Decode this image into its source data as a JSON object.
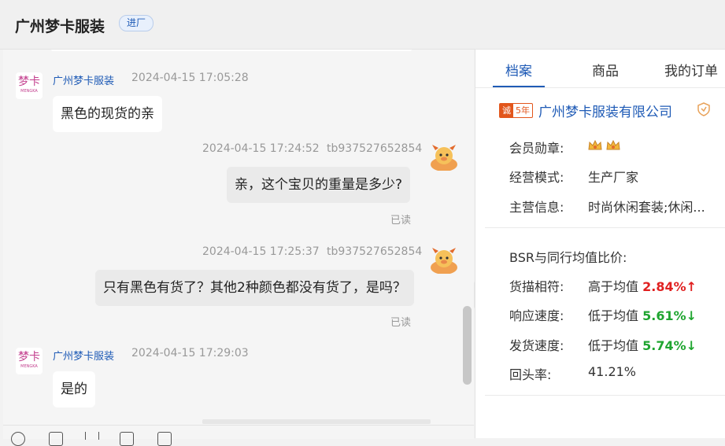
{
  "header": {
    "shop_name": "广州梦卡服装",
    "badge": "进厂"
  },
  "chat": {
    "messages": [
      {
        "sender": "广州梦卡服装",
        "time": "2024-04-15 17:05:28",
        "text": "黑色的现货的亲"
      },
      {
        "sender": "tb937527652854",
        "time": "2024-04-15 17:24:52",
        "text": "亲，这个宝贝的重量是多少?",
        "status": "已读"
      },
      {
        "sender": "tb937527652854",
        "time": "2024-04-15 17:25:37",
        "text": "只有黑色有货了？其他2种颜色都没有货了，是吗？",
        "status": "已读"
      },
      {
        "sender": "广州梦卡服装",
        "time": "2024-04-15 17:29:03",
        "text": "是的"
      }
    ],
    "shop_avatar_text": "梦卡",
    "shop_avatar_sub": "MENGKA"
  },
  "panel": {
    "tabs": [
      "档案",
      "商品",
      "我的订单"
    ],
    "company": {
      "cheng_label": "诚",
      "years": "5年",
      "name": "广州梦卡服装有限公司"
    },
    "info": {
      "member_label": "会员勋章:",
      "mode_label": "经营模式:",
      "mode_value": "生产厂家",
      "main_label": "主营信息:",
      "main_value": "时尚休闲套装;休闲..."
    },
    "bsr": {
      "title": "BSR与同行均值比价:",
      "rows": [
        {
          "label": "货描相符:",
          "prefix": "高于均值",
          "value": "2.84%",
          "arrow": "↑",
          "trend": "up"
        },
        {
          "label": "响应速度:",
          "prefix": "低于均值",
          "value": "5.61%",
          "arrow": "↓",
          "trend": "down"
        },
        {
          "label": "发货速度:",
          "prefix": "低于均值",
          "value": "5.74%",
          "arrow": "↓",
          "trend": "down"
        }
      ],
      "repeat_label": "回头率:",
      "repeat_value": "41.21%"
    }
  },
  "colors": {
    "accent": "#1f5bb6",
    "up": "#e02020",
    "down": "#1fa530",
    "cheng": "#e2561c"
  }
}
